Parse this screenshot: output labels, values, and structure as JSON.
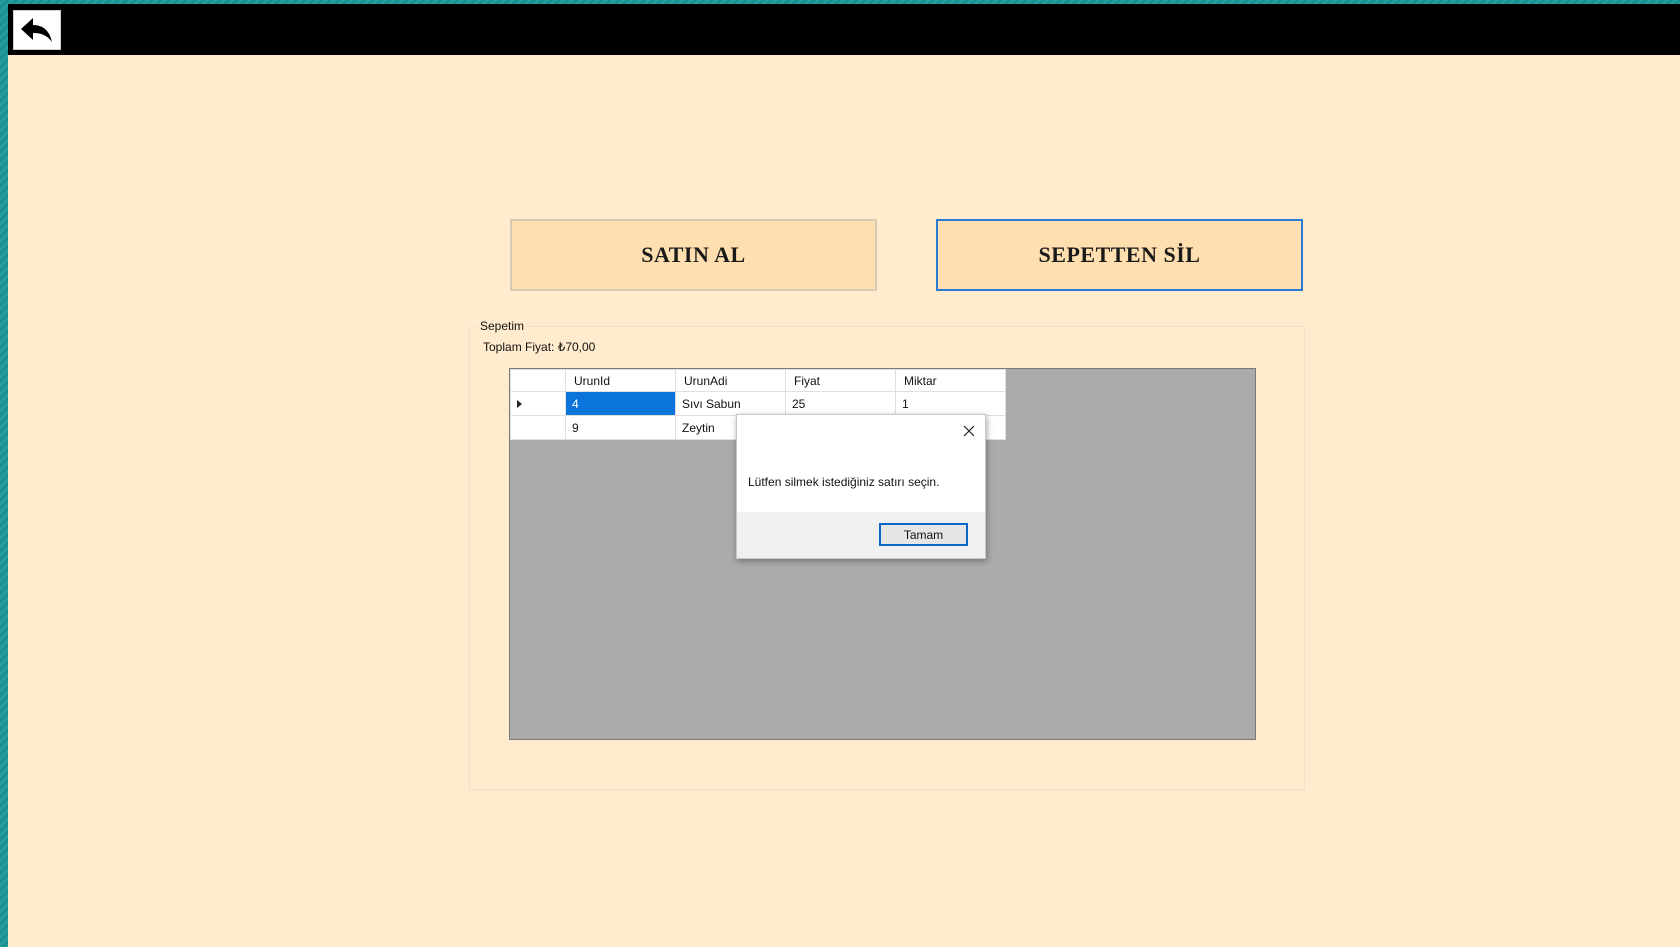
{
  "header": {
    "back_icon": "back-arrow-icon"
  },
  "actions": {
    "buy_label": "SATIN AL",
    "remove_label": "SEPETTEN SİL"
  },
  "cart": {
    "group_title": "Sepetim",
    "total_label": "Toplam Fiyat: ₺70,00",
    "columns": [
      "UrunId",
      "UrunAdi",
      "Fiyat",
      "Miktar"
    ],
    "rows": [
      {
        "id": "4",
        "name": "Sıvı Sabun",
        "price": "25",
        "qty": "1",
        "selected": true
      },
      {
        "id": "9",
        "name": "Zeytin",
        "price": "",
        "qty": "",
        "selected": false
      }
    ]
  },
  "dialog": {
    "message": "Lütfen silmek istediğiniz satırı seçin.",
    "ok_label": "Tamam",
    "close_icon": "close-icon"
  },
  "colors": {
    "window_bg": "#ffebcd",
    "titlebar": "#000000",
    "button_bg": "#ffdfb0",
    "focus_border": "#2a7ad6",
    "selection": "#0a74da",
    "grid_bg": "#ababab"
  }
}
